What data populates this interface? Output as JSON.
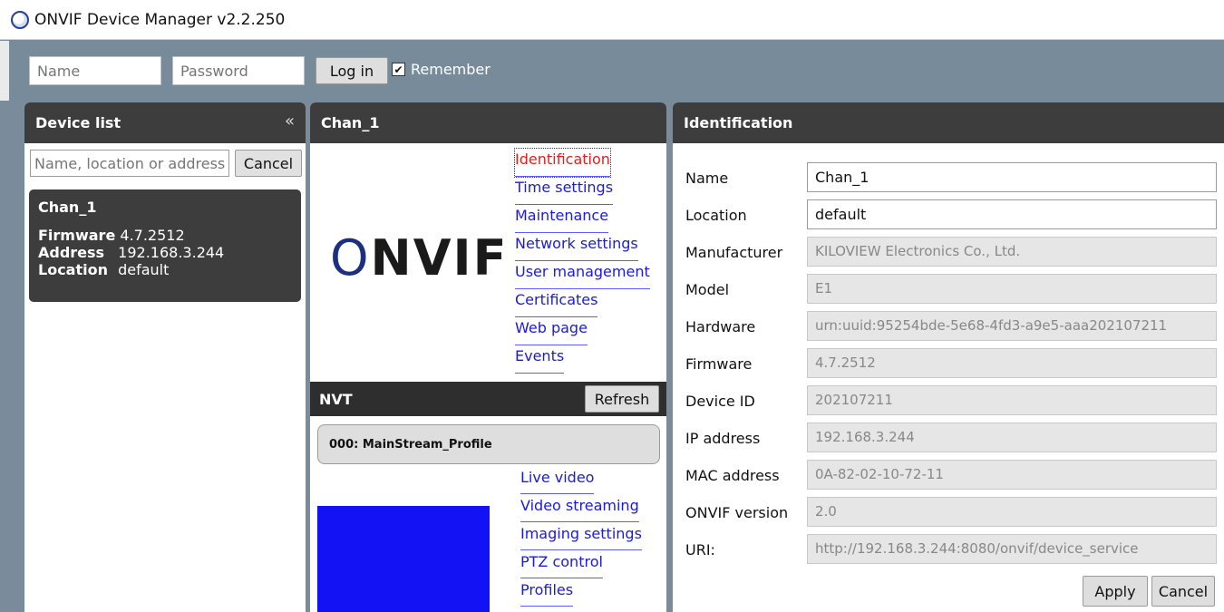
{
  "window": {
    "title": "ONVIF Device Manager v2.2.250",
    "icon": "onvif-app-icon"
  },
  "login": {
    "name_placeholder": "Name",
    "password_placeholder": "Password",
    "login_label": "Log in",
    "remember_label": "Remember",
    "remember_checked": true
  },
  "device_list": {
    "header": "Device list",
    "collapse_glyph": "«",
    "search_placeholder": "Name, location or address",
    "cancel_label": "Cancel",
    "devices": [
      {
        "name": "Chan_1",
        "firmware_key": "Firmware",
        "firmware": "4.7.2512",
        "address_key": "Address",
        "address": "192.168.3.244",
        "location_key": "Location",
        "location": "default"
      }
    ]
  },
  "channel": {
    "header": "Chan_1",
    "logo_text": "NVIF",
    "menu": [
      "Identification",
      "Time settings",
      "Maintenance",
      "Network settings",
      "User management",
      "Certificates",
      "Web page",
      "Events"
    ],
    "active_menu": "Identification",
    "nvt": {
      "header": "NVT",
      "refresh_label": "Refresh",
      "profile": "000: MainStream_Profile",
      "preview_color": "#1212f5",
      "links": [
        "Live video",
        "Video streaming",
        "Imaging settings",
        "PTZ control",
        "Profiles"
      ]
    }
  },
  "identification": {
    "header": "Identification",
    "fields": [
      {
        "label": "Name",
        "value": "Chan_1",
        "readonly": false
      },
      {
        "label": "Location",
        "value": "default",
        "readonly": false
      },
      {
        "label": "Manufacturer",
        "value": "KILOVIEW Electronics Co., Ltd.",
        "readonly": true
      },
      {
        "label": "Model",
        "value": "E1",
        "readonly": true
      },
      {
        "label": "Hardware",
        "value": "urn:uuid:95254bde-5e68-4fd3-a9e5-aaa202107211",
        "readonly": true
      },
      {
        "label": "Firmware",
        "value": "4.7.2512",
        "readonly": true
      },
      {
        "label": "Device ID",
        "value": "202107211",
        "readonly": true
      },
      {
        "label": "IP address",
        "value": "192.168.3.244",
        "readonly": true
      },
      {
        "label": "MAC address",
        "value": "0A-82-02-10-72-11",
        "readonly": true
      },
      {
        "label": "ONVIF version",
        "value": "2.0",
        "readonly": true
      },
      {
        "label": "URI:",
        "value": "http://192.168.3.244:8080/onvif/device_service",
        "readonly": true
      }
    ],
    "apply_label": "Apply",
    "cancel_label": "Cancel"
  },
  "colors": {
    "background": "#7a8b9b",
    "panel_header": "#3d3d3d",
    "link": "#1a1ae0",
    "active_link": "#e02020"
  }
}
